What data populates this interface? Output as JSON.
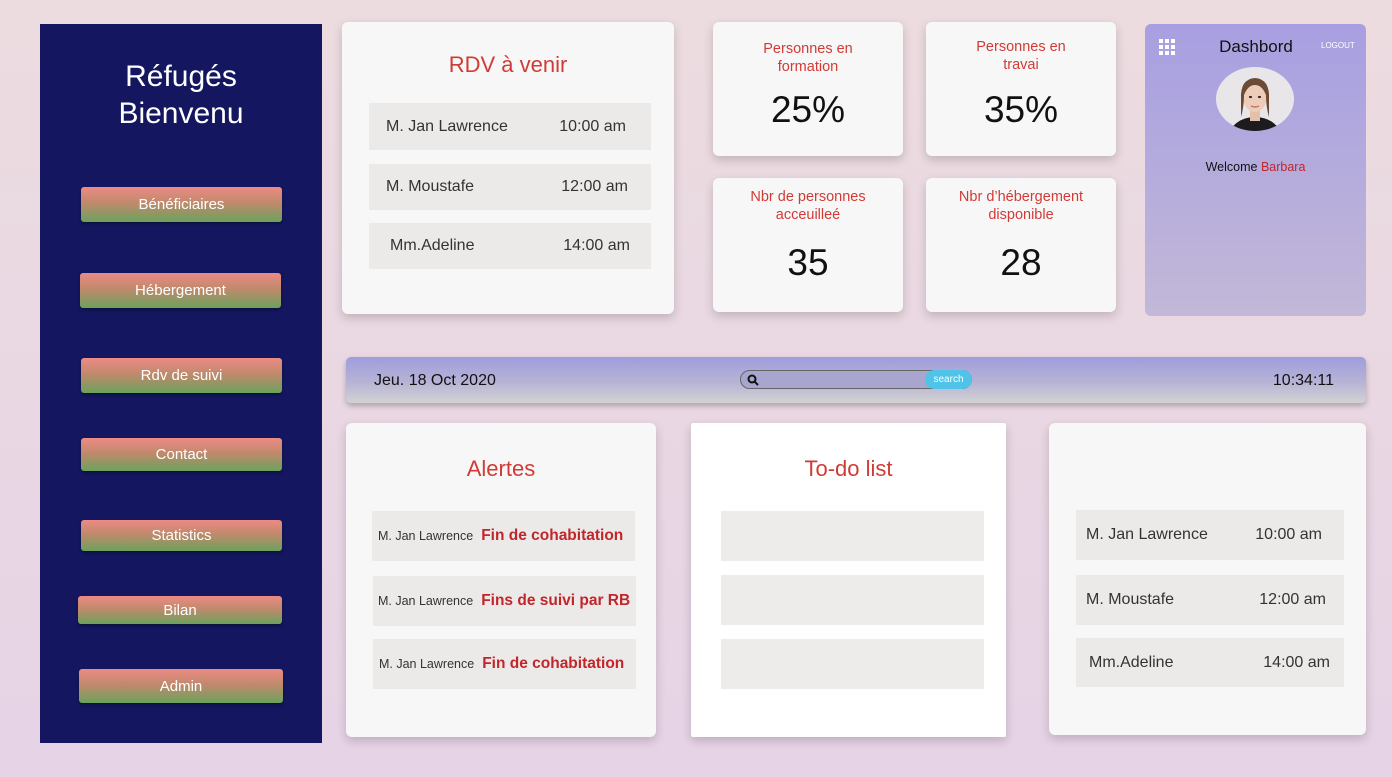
{
  "sidebar": {
    "brand_line1": "Réfugés",
    "brand_line2": "Bienvenu",
    "items": [
      {
        "label": "Bénéficiaires"
      },
      {
        "label": "Hébergement"
      },
      {
        "label": "Rdv de suivi"
      },
      {
        "label": "Contact"
      },
      {
        "label": "Statistics"
      },
      {
        "label": "Bilan"
      },
      {
        "label": "Admin"
      }
    ]
  },
  "rdv": {
    "title": "RDV à venir",
    "rows": [
      {
        "name": "M. Jan Lawrence",
        "time": "10:00 am"
      },
      {
        "name": "M. Moustafe",
        "time": "12:00 am"
      },
      {
        "name": "Mm.Adeline",
        "time": "14:00 am"
      }
    ]
  },
  "stats": [
    {
      "label": "Personnes en formation",
      "value": "25%"
    },
    {
      "label": "Personnes en travai",
      "value": "35%"
    },
    {
      "label": "Nbr de personnes acceuilleé",
      "value": "35"
    },
    {
      "label": "Nbr d’hébergement disponible",
      "value": "28"
    }
  ],
  "profile": {
    "title": "Dashbord",
    "logout_label": "LOGOUT",
    "welcome": "Welcome",
    "user_name": "Barbara"
  },
  "topbar": {
    "date": "Jeu. 18 Oct 2020",
    "search_placeholder": "",
    "search_button": "search",
    "time": "10:34:11"
  },
  "alerts": {
    "title": "Alertes",
    "rows": [
      {
        "name": "M. Jan Lawrence",
        "message": "Fin de cohabitation"
      },
      {
        "name": "M. Jan Lawrence",
        "message": "Fins de suivi par RB"
      },
      {
        "name": "M. Jan Lawrence",
        "message": "Fin de cohabitation"
      }
    ]
  },
  "todo": {
    "title": "To-do list",
    "rows": [
      "",
      "",
      ""
    ]
  },
  "appointments": {
    "rows": [
      {
        "name": "M. Jan Lawrence",
        "time": "10:00 am"
      },
      {
        "name": "M. Moustafe",
        "time": "12:00 am"
      },
      {
        "name": "Mm.Adeline",
        "time": "14:00 am"
      }
    ]
  },
  "colors": {
    "sidebar_bg": "#141760",
    "accent_red": "#d13b36",
    "search_button": "#4fc3e8"
  }
}
